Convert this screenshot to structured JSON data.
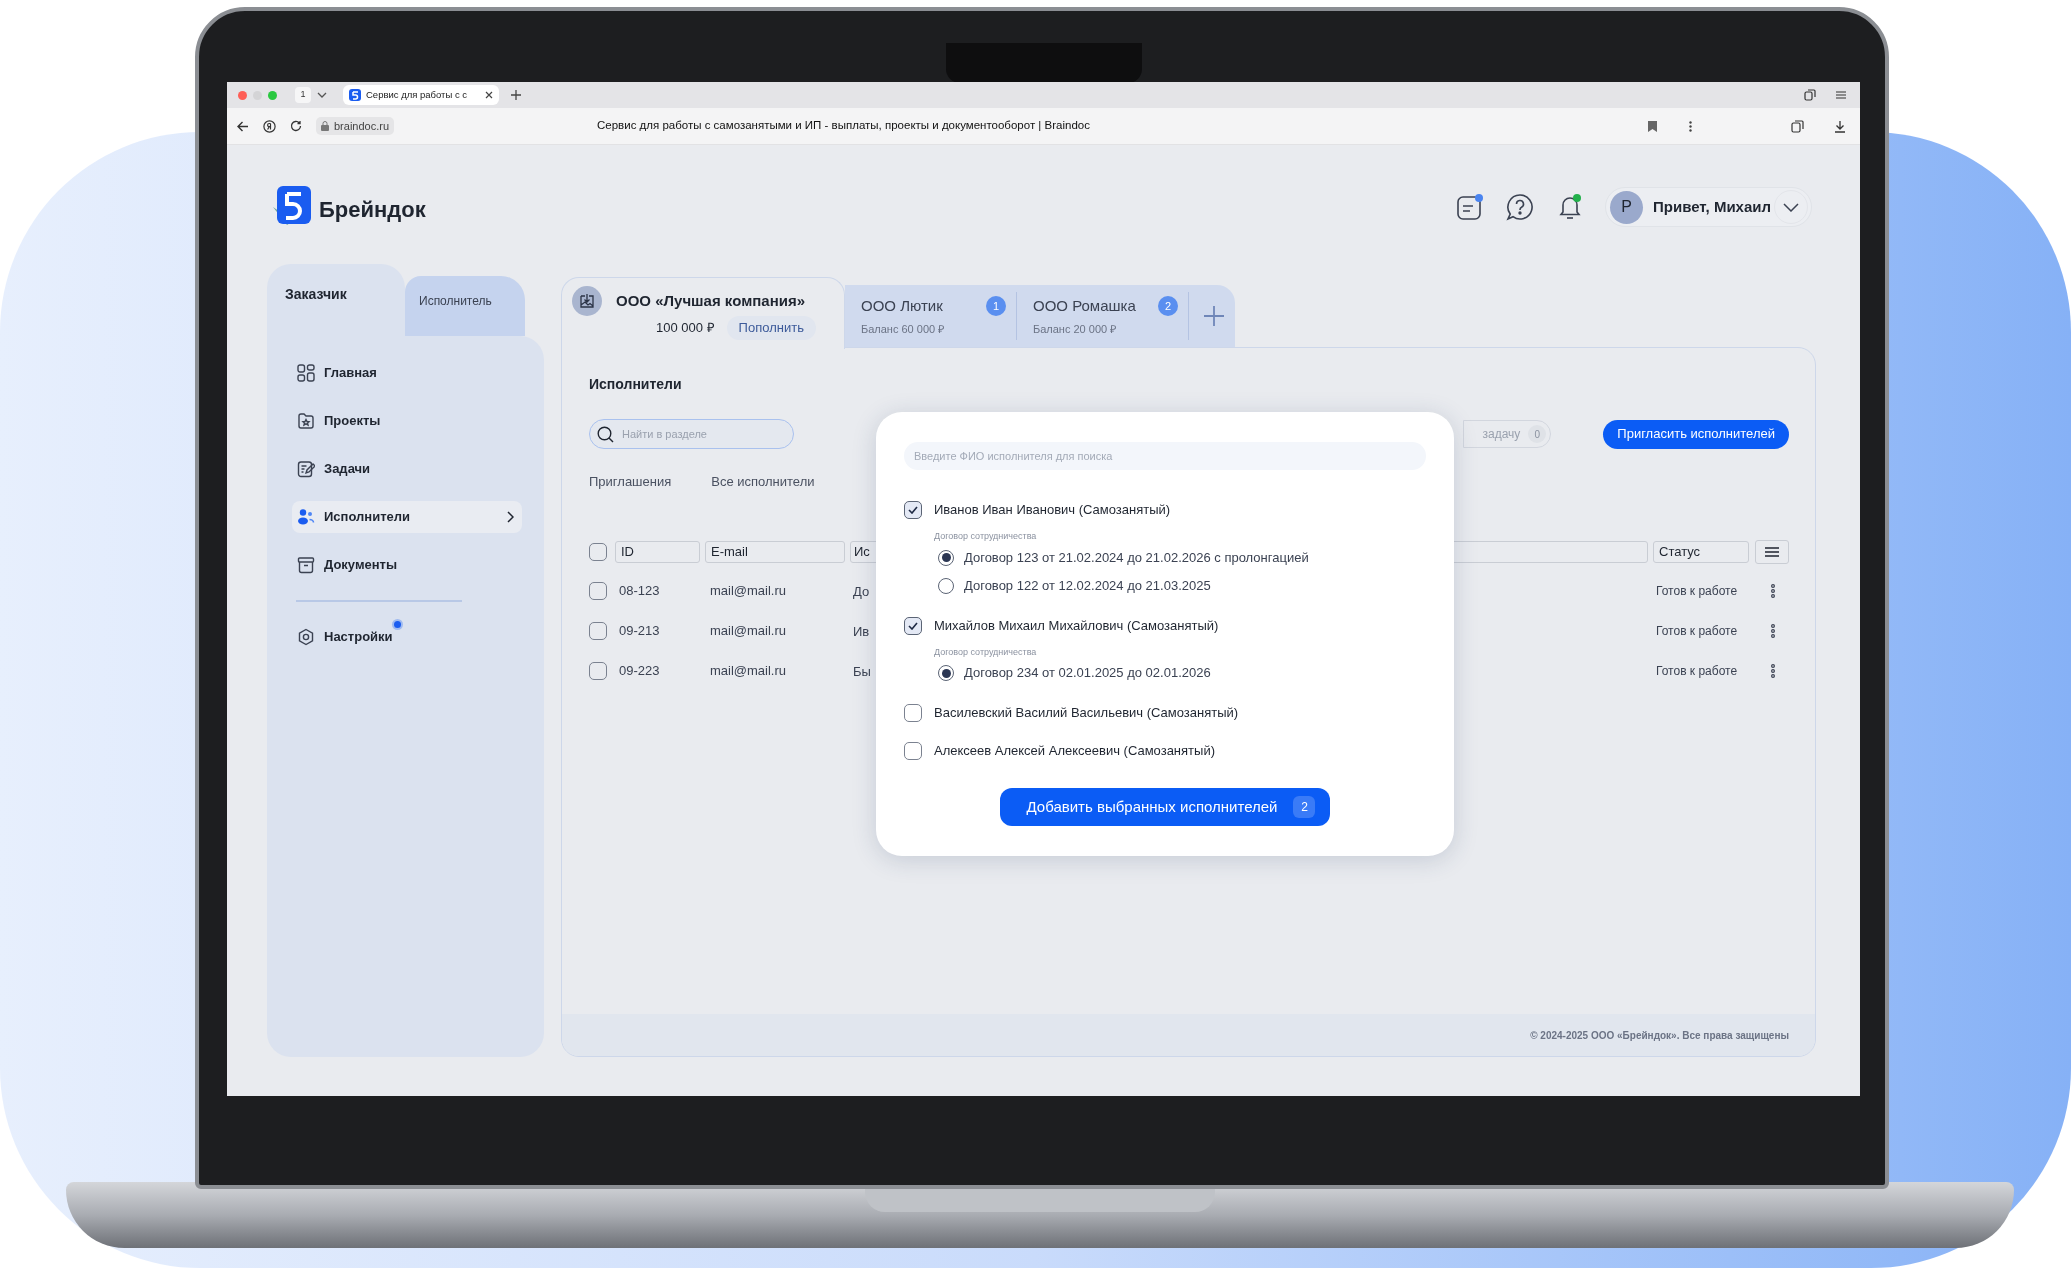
{
  "browser": {
    "tab_count": "1",
    "tab_title": "Сервис для работы с с",
    "address": "braindoc.ru",
    "page_title": "Сервис для работы с самозанятыми и ИП - выплаты, проекты и документооборот | Braindoc"
  },
  "header": {
    "logo_text": "Брейндок",
    "avatar_letter": "Р",
    "greeting": "Привет, Михаил"
  },
  "sidebar": {
    "roles": [
      {
        "label": "Заказчик",
        "selected": true
      },
      {
        "label": "Исполнитель",
        "selected": false
      }
    ],
    "items": [
      {
        "label": "Главная",
        "kind": "home",
        "selected": false,
        "dot": false
      },
      {
        "label": "Проекты",
        "kind": "projects",
        "selected": false,
        "dot": false
      },
      {
        "label": "Задачи",
        "kind": "tasks",
        "selected": false,
        "dot": false
      },
      {
        "label": "Исполнители",
        "kind": "people",
        "selected": true,
        "dot": false
      },
      {
        "label": "Документы",
        "kind": "documents",
        "selected": false,
        "dot": false
      },
      {
        "label": "Настройки",
        "kind": "settings",
        "selected": false,
        "dot": true
      }
    ]
  },
  "company_tabs": [
    {
      "name": "ООО «Лучшая компания»",
      "balance": "100 000 ₽",
      "action": "Пополнить",
      "selected": true
    },
    {
      "name": "ООО Лютик",
      "balance": "Баланс 60 000 ₽",
      "count": "1",
      "selected": false
    },
    {
      "name": "ООО Ромашка",
      "balance": "Баланс 20 000 ₽",
      "count": "2",
      "selected": false
    }
  ],
  "section": {
    "title": "Исполнители",
    "search": {
      "placeholder": "Найти в разделе"
    },
    "tabs": [
      {
        "label": "Приглашения",
        "selected": false
      },
      {
        "label": "Все исполнители",
        "selected": false
      }
    ],
    "task_button": {
      "label": "задачу",
      "count": "0"
    },
    "invite_button": "Пригласить исполнителей"
  },
  "table": {
    "all_checked": false,
    "columns": [
      "ID",
      "E-mail",
      "Ис",
      "Статус"
    ],
    "rows": [
      {
        "checked": false,
        "cells": [
          "08-123",
          "mail@mail.ru",
          "До",
          "Готов к работе"
        ]
      },
      {
        "checked": false,
        "cells": [
          "09-213",
          "mail@mail.ru",
          "Ив",
          "Готов к работе"
        ]
      },
      {
        "checked": false,
        "cells": [
          "09-223",
          "mail@mail.ru",
          "Бы",
          "Готов к работе"
        ]
      }
    ]
  },
  "modal": {
    "search": {
      "placeholder": "Введите ФИО исполнителя для поиска"
    },
    "candidates": [
      {
        "name": "Иванов Иван Иванович (Самозанятый)",
        "checked": true,
        "contracts_label": "Договор сотрудничества",
        "contracts": [
          {
            "label": "Договор 123 от 21.02.2024 до 21.02.2026 с пролонгацией",
            "selected": true
          },
          {
            "label": "Договор 122 от 12.02.2024 до 21.03.2025",
            "selected": false
          }
        ]
      },
      {
        "name": "Михайлов Михаил Михайлович (Самозанятый)",
        "checked": true,
        "contracts_label": "Договор сотрудничества",
        "contracts": [
          {
            "label": "Договор 234 от 02.01.2025 до 02.01.2026",
            "selected": true
          }
        ]
      },
      {
        "name": "Василевский Василий Васильевич (Самозанятый)",
        "checked": false
      },
      {
        "name": "Алексеев Алексей Алексеевич (Самозанятый)",
        "checked": false
      }
    ],
    "submit": {
      "label": "Добавить выбранных исполнителей",
      "count": "2"
    }
  },
  "footer": "© 2024-2025 ООО «Брейндок». Все права защищены"
}
